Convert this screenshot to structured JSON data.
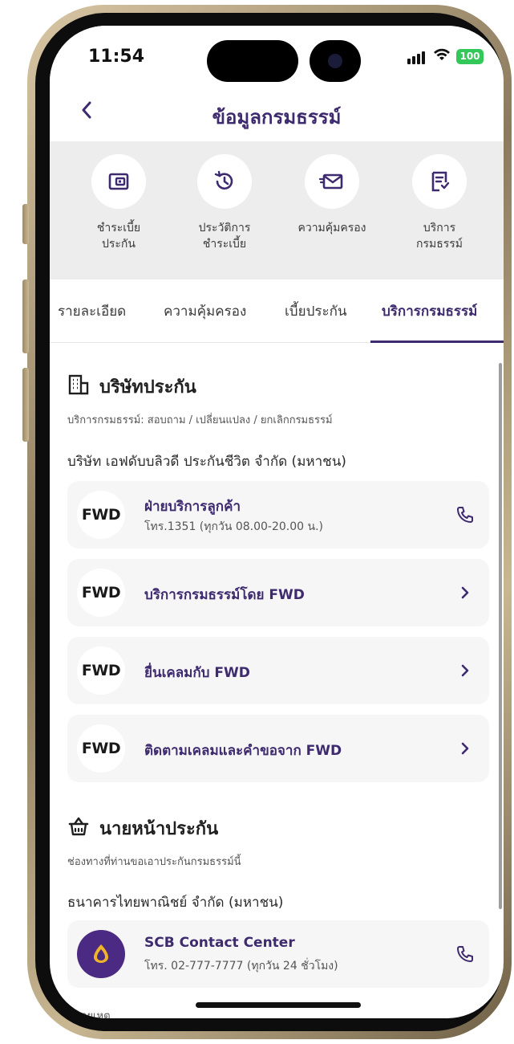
{
  "status_bar": {
    "time": "11:54",
    "battery": "100"
  },
  "header": {
    "back_label": "<",
    "title": "ข้อมูลกรมธรรม์"
  },
  "quick_actions": [
    {
      "label_line1": "ชำระเบี้ย",
      "label_line2": "ประกัน",
      "icon": "wallet-icon"
    },
    {
      "label_line1": "ประวัติการ",
      "label_line2": "ชำระเบี้ย",
      "icon": "history-icon"
    },
    {
      "label_line1": "ความคุ้มครอง",
      "label_line2": "",
      "icon": "mail-icon"
    },
    {
      "label_line1": "บริการ",
      "label_line2": "กรมธรรม์",
      "icon": "document-icon"
    }
  ],
  "tabs": [
    {
      "label": "รายละเอียด"
    },
    {
      "label": "ความคุ้มครอง"
    },
    {
      "label": "เบี้ยประกัน"
    },
    {
      "label": "บริการกรมธรรม์"
    }
  ],
  "insurer_section": {
    "title": "บริษัทประกัน",
    "subtitle": "บริการกรมธรรม์: สอบถาม / เปลี่ยนแปลง / ยกเลิกกรมธรรม์",
    "company": "บริษัท เอฟดับบลิวดี ประกันชีวิต จำกัด (มหาชน)",
    "logo_text": "FWD",
    "cards": [
      {
        "title": "ฝ่ายบริการลูกค้า",
        "subtitle": "โทร.1351 (ทุกวัน 08.00-20.00 น.)",
        "action": "phone-icon"
      },
      {
        "title": "บริการกรมธรรม์โดย FWD",
        "subtitle": "",
        "action": "chevron-right-icon"
      },
      {
        "title": "ยื่นเคลมกับ FWD",
        "subtitle": "",
        "action": "chevron-right-icon"
      },
      {
        "title": "ติดตามเคลมและคำขอจาก FWD",
        "subtitle": "",
        "action": "chevron-right-icon"
      }
    ]
  },
  "broker_section": {
    "title": "นายหน้าประกัน",
    "subtitle": "ช่องทางที่ท่านขอเอาประกันกรมธรรม์นี้",
    "company": "ธนาคารไทยพาณิชย์ จำกัด (มหาชน)",
    "card": {
      "title": "SCB Contact Center",
      "subtitle": "โทร. 02-777-7777 (ทุกวัน 24 ชั่วโมง)"
    }
  },
  "footer_peek": "หมายเหตุ",
  "colors": {
    "brand": "#3e2a6e",
    "scb": "#4a2a82",
    "battery": "#34c759"
  }
}
